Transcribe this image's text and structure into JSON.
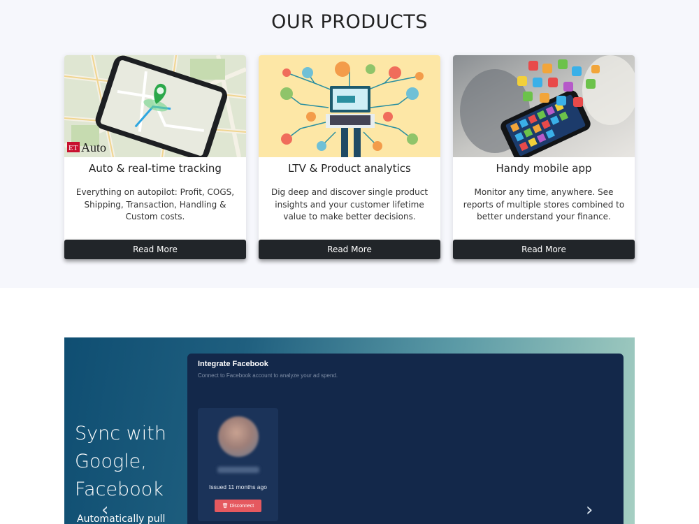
{
  "products": {
    "title": "OUR PRODUCTS",
    "cards": [
      {
        "image": "phone-map-tracking-image",
        "image_text": "ET Auto",
        "title": "Auto & real-time tracking",
        "description": "Everything on autopilot: Profit, COGS, Shipping, Transaction, Handling & Custom costs.",
        "button": "Read More"
      },
      {
        "image": "analytics-network-illustration",
        "title": "LTV & Product analytics",
        "description": "Dig deep and discover single product insights and your customer lifetime value to make better decisions.",
        "button": "Read More"
      },
      {
        "image": "smartphone-app-icons-image",
        "title": "Handy mobile app",
        "description": "Monitor any time, anywhere. See reports of multiple stores combined to better understand your finance.",
        "button": "Read More"
      }
    ]
  },
  "banner": {
    "heading": "Sync with Google, Facebook",
    "subheading": "Automatically pull",
    "panel": {
      "title": "Integrate Facebook",
      "subtitle": "Connect to Facebook account to analyze your ad spend.",
      "account": {
        "issued": "Issued 11 months ago",
        "disconnect_label": "Disconnect",
        "disconnect_icon": "trash-icon"
      }
    },
    "prev_icon": "chevron-left-icon",
    "next_icon": "chevron-right-icon"
  },
  "colors": {
    "section_bg": "#f6f7fc",
    "button_dark": "#212529",
    "panel_bg": "#13284a",
    "disconnect_red": "#e5595f"
  }
}
